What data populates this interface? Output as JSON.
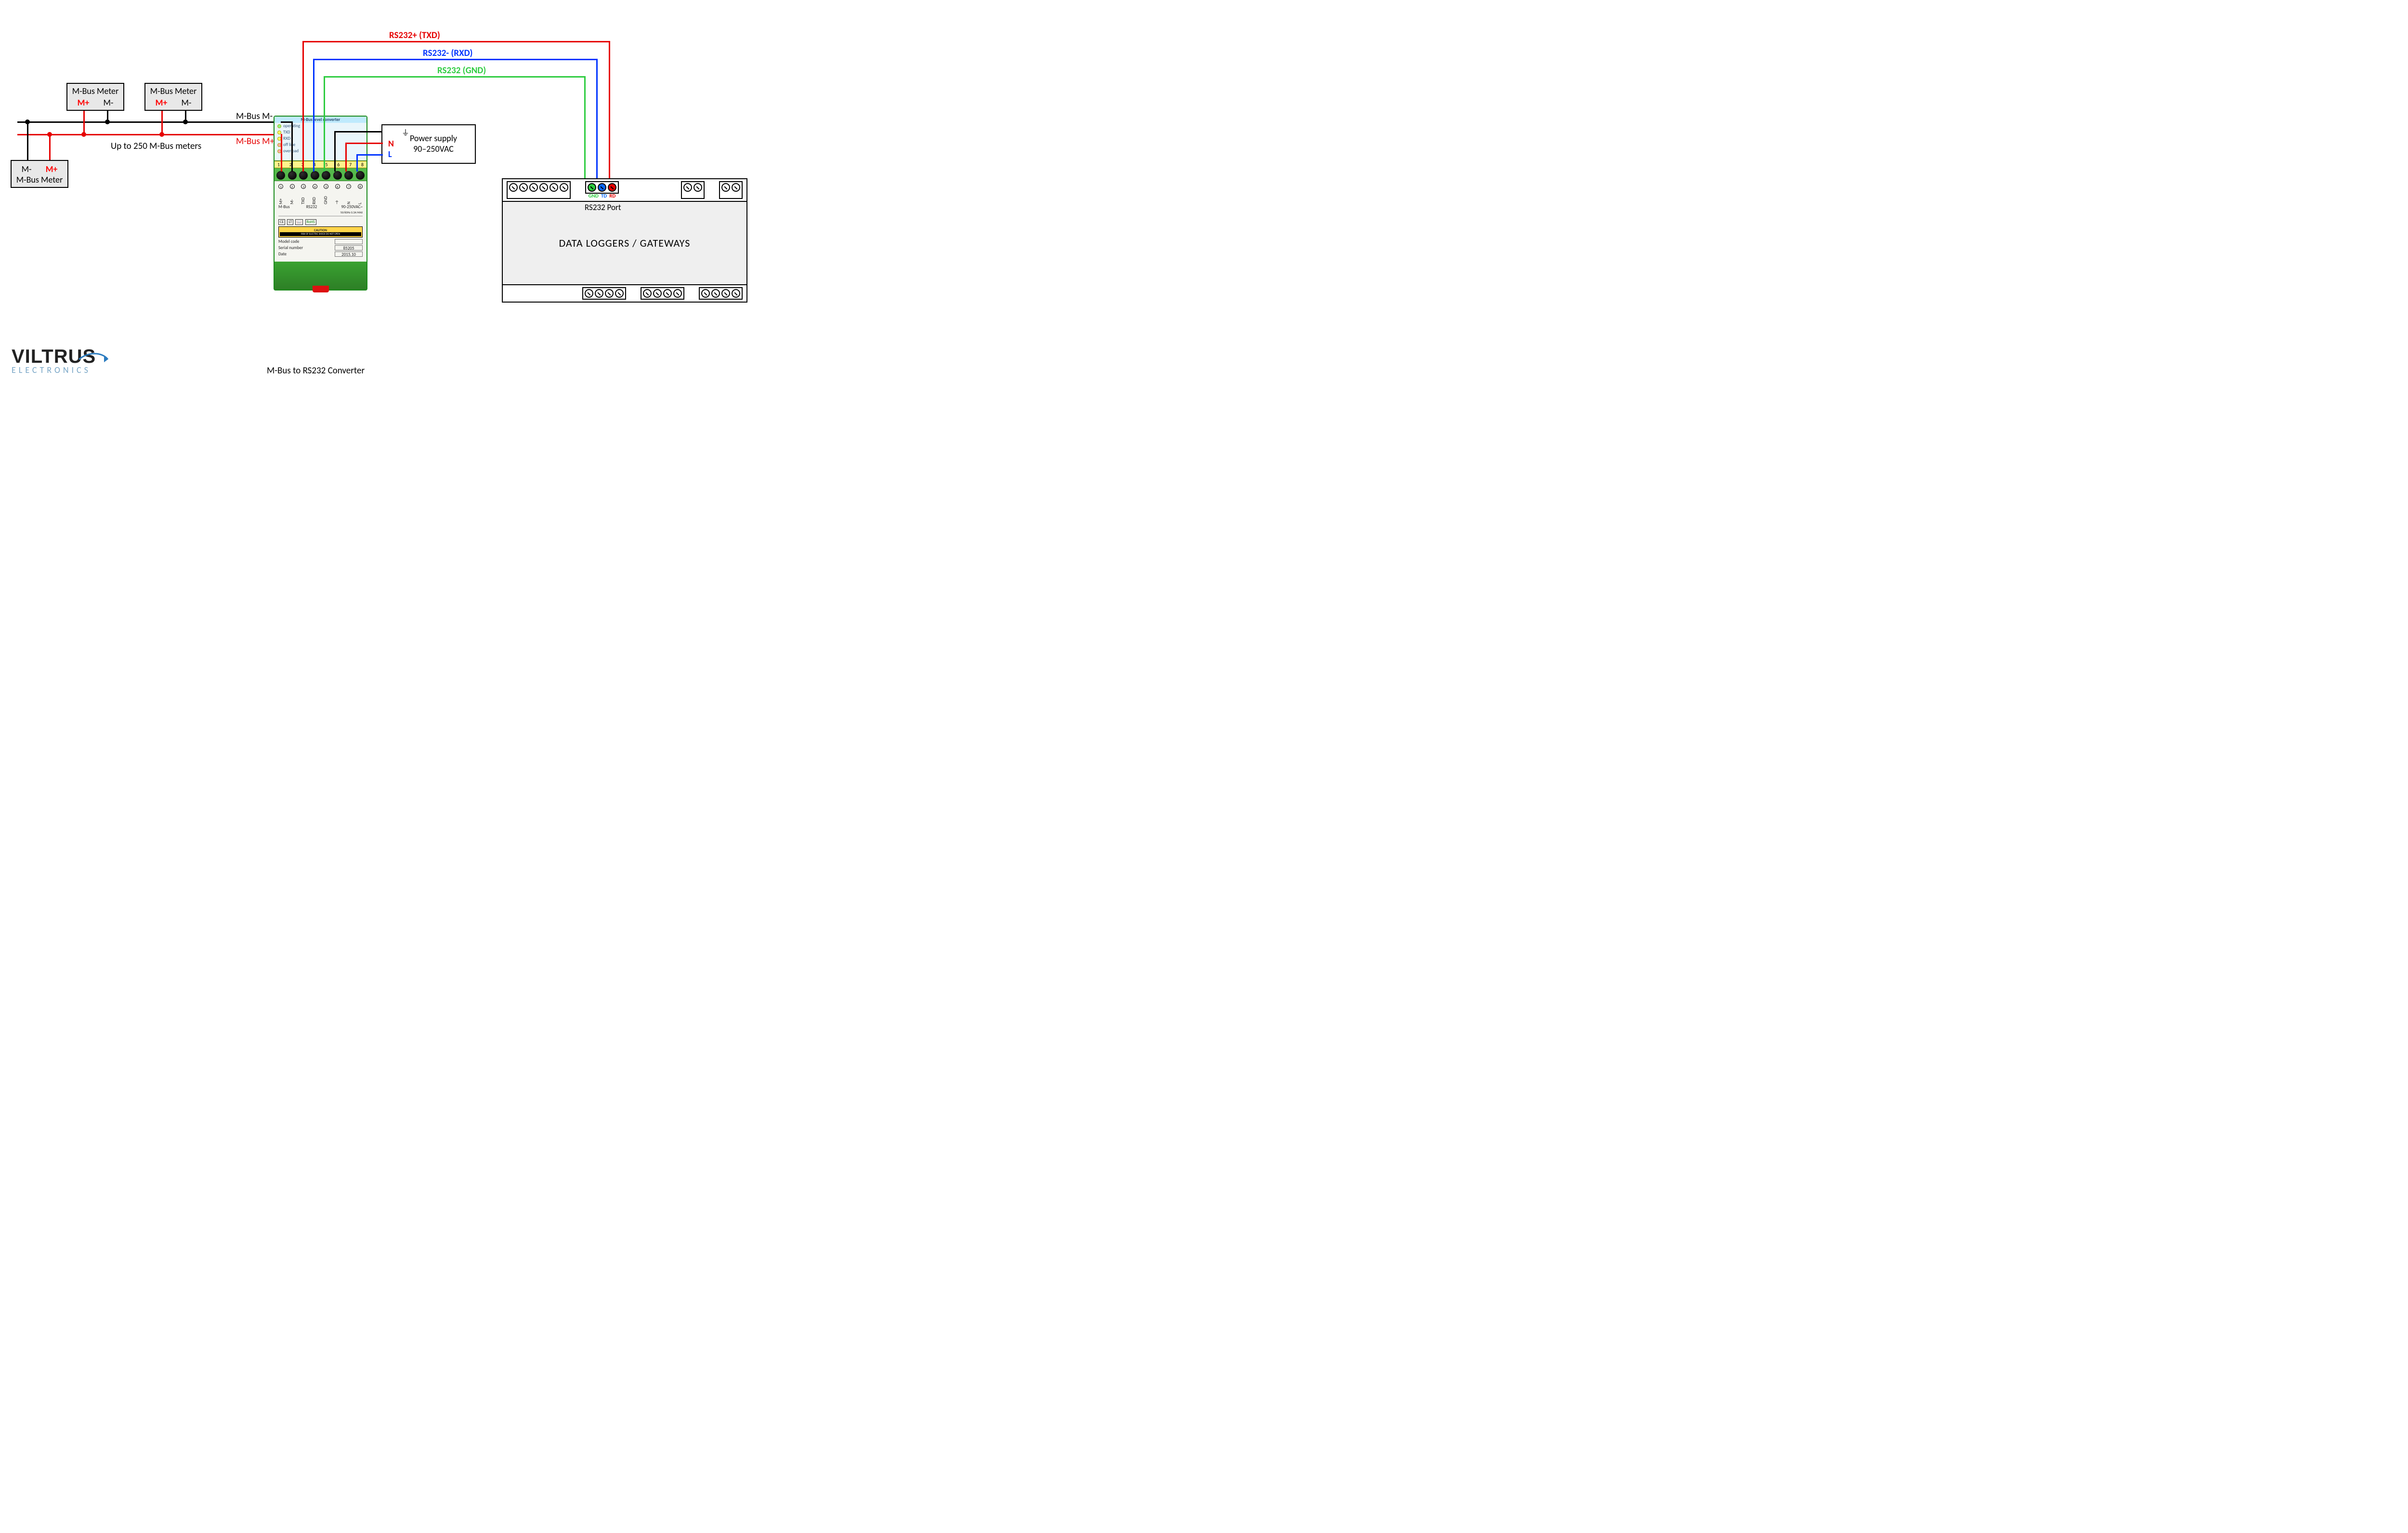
{
  "logo": {
    "line1": "VILTRUS",
    "line2": "ELECTRONICS"
  },
  "meters": {
    "label": "M-Bus Meter",
    "pin_plus": "M+",
    "pin_minus": "M-",
    "bus_plus_label": "M-Bus M+",
    "bus_minus_label": "M-Bus M-",
    "count_note": "Up to 250 M-Bus meters"
  },
  "rs232": {
    "txd": "RS232+ (TXD)",
    "rxd": "RS232-  (RXD)",
    "gnd": "RS232  (GND)"
  },
  "psu": {
    "ground_sym": "⏚",
    "n": "N",
    "l": "L",
    "title": "Power supply",
    "range": "90–250VAC"
  },
  "converter": {
    "caption": "M-Bus to RS232 Converter",
    "top_title": "M-Bus level converter",
    "top_rows": [
      "operating",
      "TXD",
      "RXD",
      "off line",
      "overload"
    ],
    "terminal_numbers": [
      "1",
      "2",
      "3",
      "4",
      "5",
      "6",
      "7",
      "8"
    ],
    "pin_names": [
      "M+",
      "M-",
      "TXD",
      "RXD",
      "GND",
      "⏚",
      "N",
      "L"
    ],
    "groups": {
      "g1": "M-Bus",
      "g2": "RS232",
      "g3": "90-250VAC~",
      "g3b": "50/60Hz 0.3A MAX"
    },
    "badges": [
      "CE",
      "LT",
      "📖",
      "RoHS"
    ],
    "caution_title": "CAUTION",
    "caution_body": "RISK OF ELECTRIC SHOCK  DO NOT OPEN",
    "fields": {
      "model_label": "Model code",
      "model_value": "",
      "serial_label": "Serial number",
      "serial_value": "85205",
      "date_label": "Date",
      "date_value": "2015.10"
    }
  },
  "logger": {
    "title": "DATA LOGGERS / GATEWAYS",
    "port_label": "RS232 Port",
    "pins": {
      "gnd": "GND",
      "td": "TD",
      "rd": "RD"
    }
  }
}
